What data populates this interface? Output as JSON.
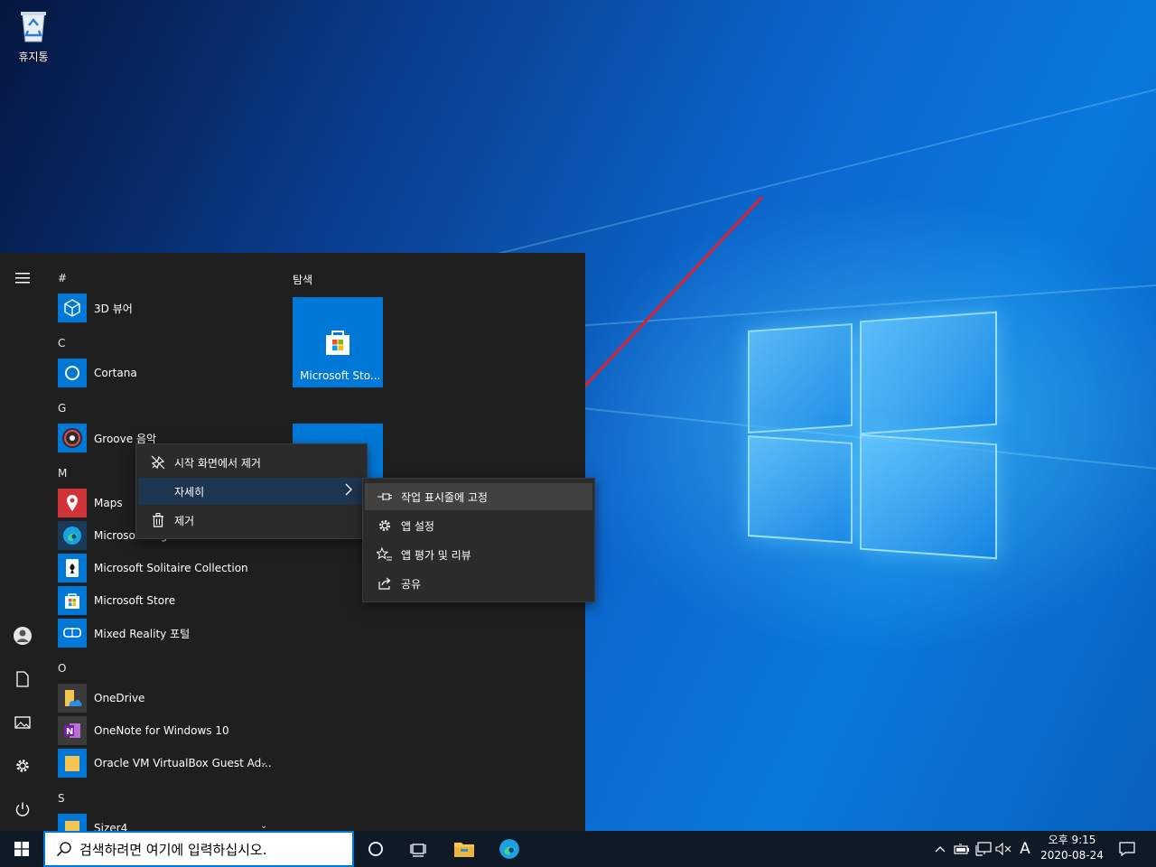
{
  "desktop": {
    "recycle_bin_label": "휴지통"
  },
  "start_menu": {
    "groups": {
      "hash": "#",
      "c": "C",
      "g": "G",
      "m": "M",
      "o": "O",
      "s": "S"
    },
    "apps": {
      "viewer3d": "3D 뷰어",
      "cortana": "Cortana",
      "groove": "Groove 음악",
      "maps": "Maps",
      "edge": "Microsoft Edge",
      "solitaire": "Microsoft Solitaire Collection",
      "store": "Microsoft Store",
      "mixed_reality": "Mixed Reality 포털",
      "onedrive": "OneDrive",
      "onenote": "OneNote for Windows 10",
      "virtualbox": "Oracle VM VirtualBox Guest Ad...",
      "sizer": "Sizer4"
    },
    "tiles_header": "탐색",
    "store_tile_label": "Microsoft Sto..."
  },
  "context_menu": {
    "unpin": "시작 화면에서 제거",
    "more": "자세히",
    "uninstall": "제거"
  },
  "submenu": {
    "pin_taskbar": "작업 표시줄에 고정",
    "app_settings": "앱 설정",
    "rate_review": "앱 평가 및 리뷰",
    "share": "공유"
  },
  "taskbar": {
    "search_placeholder": "검색하려면 여기에 입력하십시오.",
    "ime": "A",
    "time": "오후 9:15",
    "date": "2020-08-24"
  },
  "colors": {
    "accent": "#0078d7",
    "annotation_arrow": "#e0202a"
  }
}
